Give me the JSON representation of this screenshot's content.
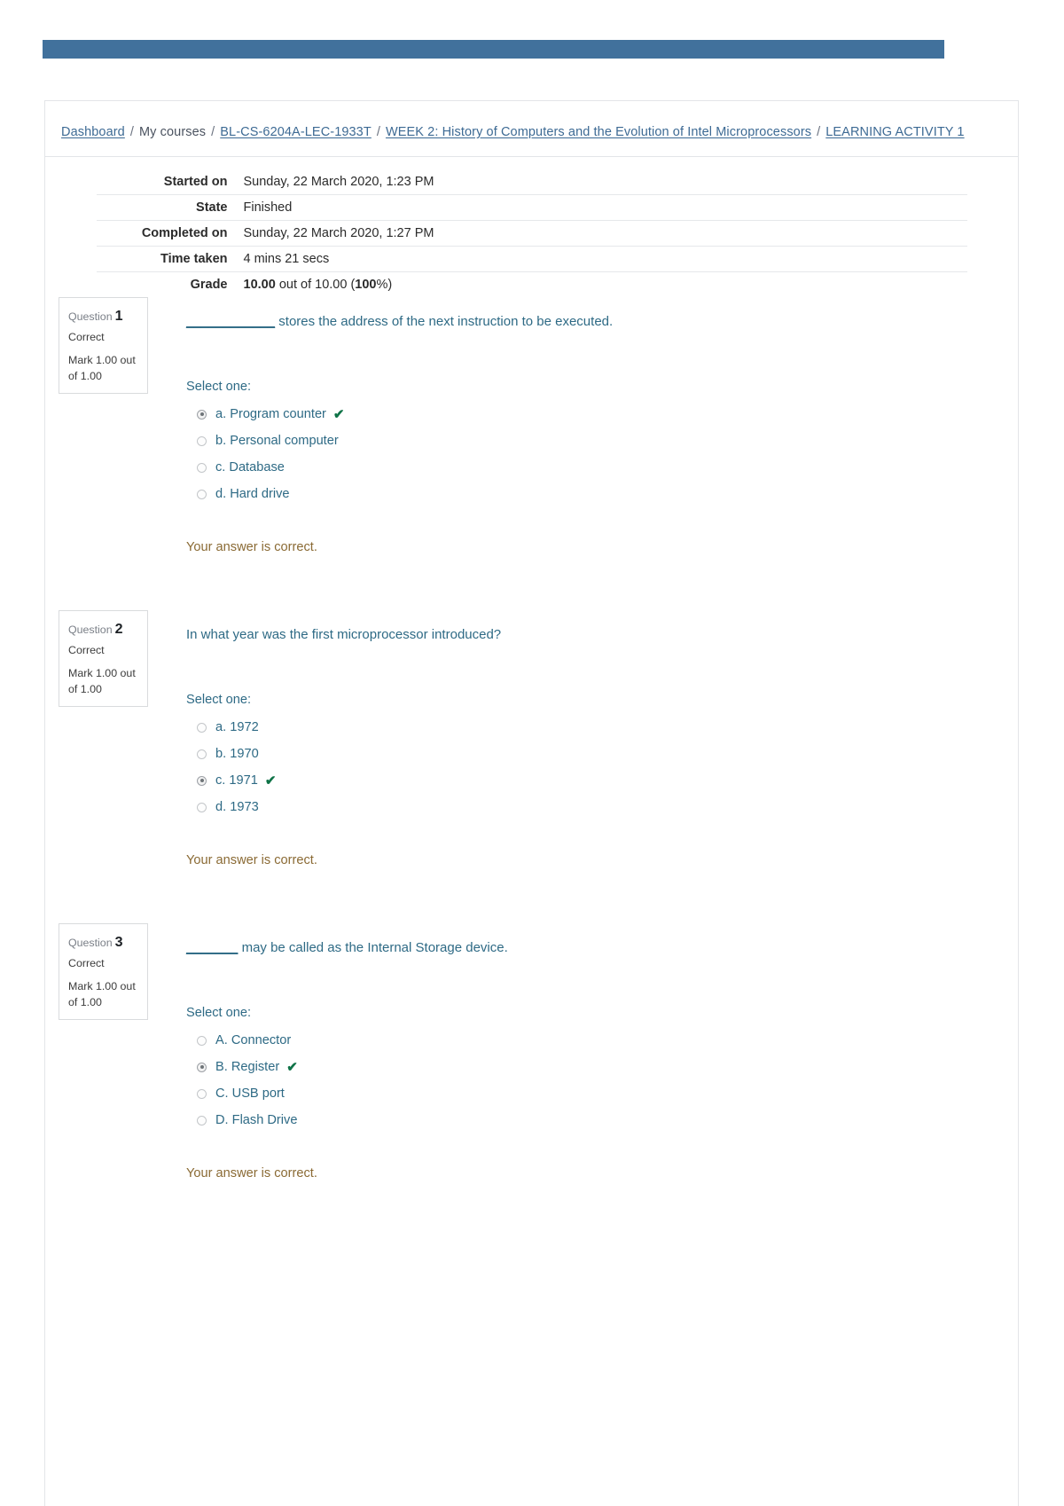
{
  "theme": {
    "navbar_color": "#41719c",
    "link_color": "#3d6a94",
    "question_text_color": "#2e6a85",
    "feedback_color": "#8a6a34",
    "tick_color": "#0f7347"
  },
  "breadcrumb": {
    "items": [
      {
        "label": "Dashboard",
        "link": true
      },
      {
        "label": "My courses",
        "link": false
      },
      {
        "label": "BL-CS-6204A-LEC-1933T",
        "link": true
      },
      {
        "label": "WEEK 2: History of Computers and the Evolution of Intel Microprocessors",
        "link": true
      },
      {
        "label": "LEARNING ACTIVITY 1",
        "link": true
      }
    ],
    "separator": "/"
  },
  "summary": {
    "rows": [
      {
        "label": "Started on",
        "value": "Sunday, 22 March 2020, 1:23 PM"
      },
      {
        "label": "State",
        "value": "Finished"
      },
      {
        "label": "Completed on",
        "value": "Sunday, 22 March 2020, 1:27 PM"
      },
      {
        "label": "Time taken",
        "value": "4 mins 21 secs"
      }
    ],
    "grade": {
      "label": "Grade",
      "score": "10.00",
      "middle": " out of 10.00 (",
      "percent": "100",
      "suffix": "%)"
    }
  },
  "labels": {
    "question_word": "Question",
    "select_one": "Select one:",
    "tick_glyph": "✔"
  },
  "questions": [
    {
      "number": "1",
      "state": "Correct",
      "mark": "Mark 1.00 out of 1.00",
      "text_blank": "____________",
      "text": " stores the address of the next instruction to be executed.",
      "options": [
        {
          "label": "a. Program counter",
          "selected": true,
          "correct": true
        },
        {
          "label": "b. Personal computer",
          "selected": false,
          "correct": false
        },
        {
          "label": "c. Database",
          "selected": false,
          "correct": false
        },
        {
          "label": "d. Hard drive",
          "selected": false,
          "correct": false
        }
      ],
      "feedback": "Your answer is correct."
    },
    {
      "number": "2",
      "state": "Correct",
      "mark": "Mark 1.00 out of 1.00",
      "text_blank": "",
      "text": "In what year was the first microprocessor introduced?",
      "options": [
        {
          "label": "a. 1972",
          "selected": false,
          "correct": false
        },
        {
          "label": "b. 1970",
          "selected": false,
          "correct": false
        },
        {
          "label": "c. 1971",
          "selected": true,
          "correct": true
        },
        {
          "label": "d. 1973",
          "selected": false,
          "correct": false
        }
      ],
      "feedback": "Your answer is correct."
    },
    {
      "number": "3",
      "state": "Correct",
      "mark": "Mark 1.00 out of 1.00",
      "text_blank": "_______",
      "text": " may be called as the Internal Storage device.",
      "options": [
        {
          "label": "A. Connector",
          "selected": false,
          "correct": false
        },
        {
          "label": "B. Register",
          "selected": true,
          "correct": true
        },
        {
          "label": "C. USB port",
          "selected": false,
          "correct": false
        },
        {
          "label": "D. Flash Drive",
          "selected": false,
          "correct": false
        }
      ],
      "feedback": "Your answer is correct."
    }
  ]
}
